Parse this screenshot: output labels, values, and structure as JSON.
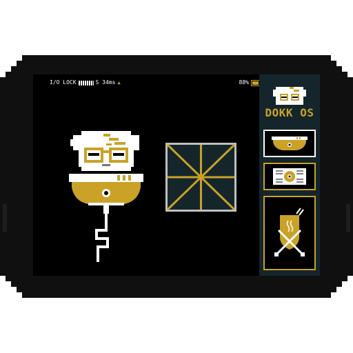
{
  "status": {
    "lock_label": "I/O LOCK",
    "ping_label": "S 34ms",
    "battery_percent": 88,
    "battery_label": "88%"
  },
  "sidebar": {
    "title": "DOKK OS",
    "items": [
      {
        "icon": "drone-bowl-icon",
        "selected": true
      },
      {
        "icon": "gadget-device-icon",
        "selected": false
      },
      {
        "icon": "badge-shield-icon",
        "selected": false
      }
    ]
  },
  "colors": {
    "accent": "#c9a227",
    "screen": "#000000",
    "sidebar": "#14262b",
    "frame": "#101010",
    "white": "#ffffff"
  }
}
